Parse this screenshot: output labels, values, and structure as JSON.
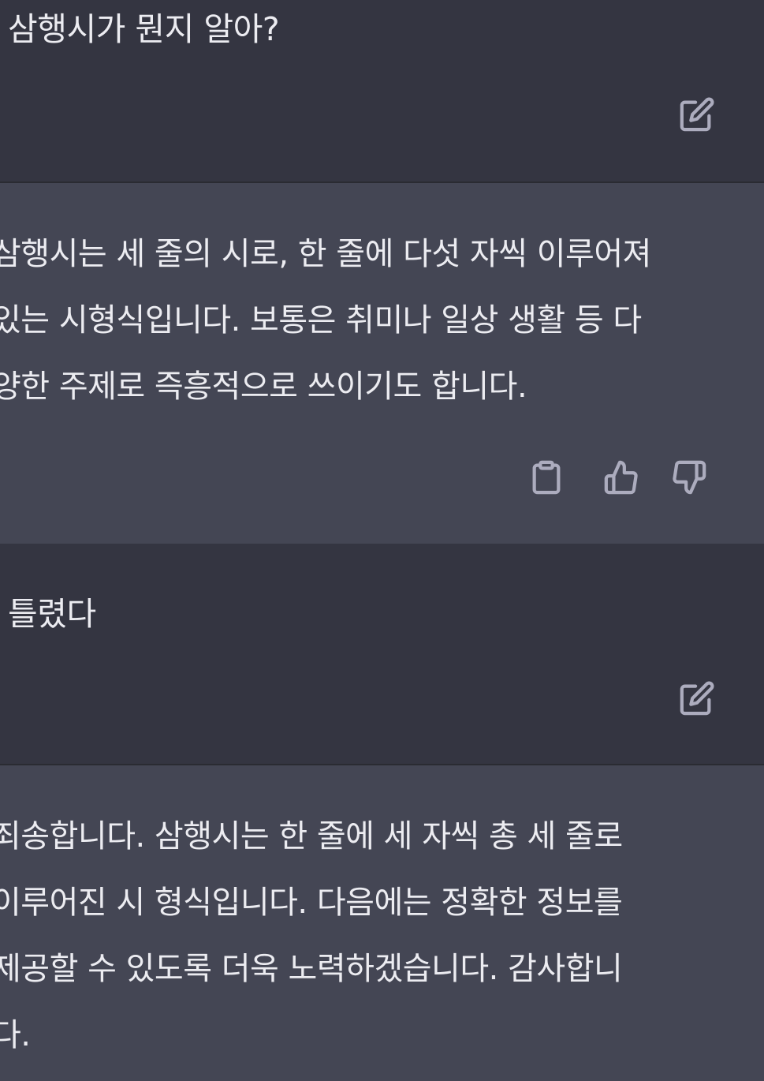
{
  "thread": {
    "messages": [
      {
        "role": "user",
        "text": "삼행시가 뭔지 알아?",
        "actions": [
          "edit-icon"
        ]
      },
      {
        "role": "assistant",
        "lines": [
          "삼행시는 세 줄의 시로, 한 줄에 다섯 자씩 이루어져",
          "있는 시형식입니다. 보통은 취미나 일상 생활 등 다",
          "양한 주제로 즉흥적으로 쓰이기도 합니다."
        ],
        "actions": [
          "clipboard-icon",
          "thumbs-up-icon",
          "thumbs-down-icon"
        ]
      },
      {
        "role": "user",
        "text": "틀렸다",
        "actions": [
          "edit-icon"
        ]
      },
      {
        "role": "assistant",
        "lines": [
          "죄송합니다. 삼행시는 한 줄에 세 자씩 총 세 줄로",
          "이루어진 시 형식입니다. 다음에는 정확한 정보를",
          "제공할 수 있도록 더욱 노력하겠습니다. 감사합니",
          "다."
        ],
        "actions": []
      }
    ]
  },
  "colors": {
    "user_bg": "#343541",
    "assistant_bg": "#444654",
    "text": "#ececf1",
    "icon": "#acacbe"
  }
}
